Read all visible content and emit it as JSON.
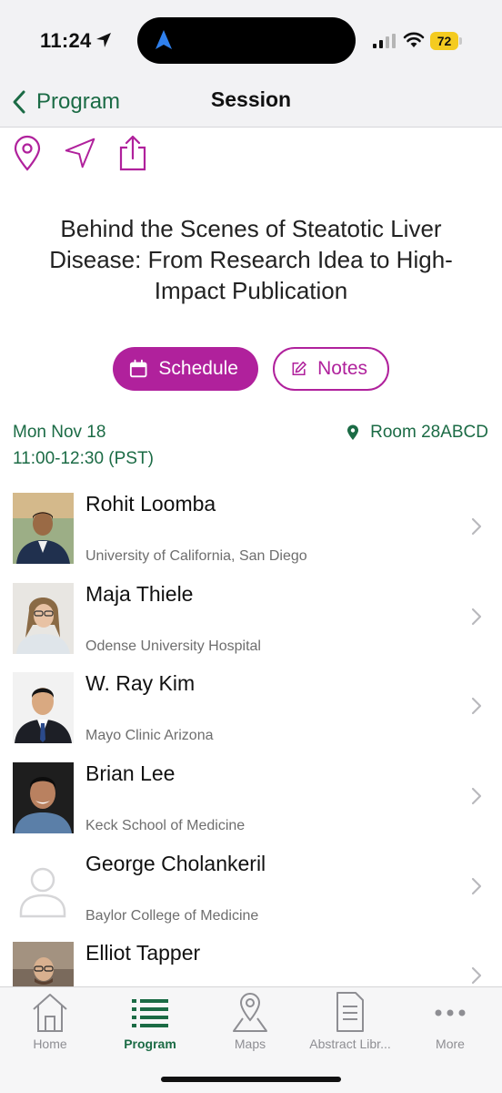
{
  "status_bar": {
    "time": "11:24",
    "battery": "72"
  },
  "nav": {
    "back_label": "Program",
    "title": "Session"
  },
  "actions": [
    {
      "icon": "location-pin-icon"
    },
    {
      "icon": "navigate-arrow-icon"
    },
    {
      "icon": "share-icon"
    }
  ],
  "session": {
    "title": "Behind the Scenes of Steatotic Liver Disease: From Research Idea to High-Impact Publication",
    "date": "Mon Nov 18",
    "time": "11:00-12:30 (PST)",
    "room": "Room 28ABCD"
  },
  "buttons": {
    "schedule": "Schedule",
    "notes": "Notes"
  },
  "speakers": [
    {
      "name": "Rohit Loomba",
      "org": "University of California, San Diego",
      "photo": "photo"
    },
    {
      "name": "Maja Thiele",
      "org": "Odense University Hospital",
      "photo": "photo"
    },
    {
      "name": "W. Ray Kim",
      "org": "Mayo Clinic Arizona",
      "photo": "photo"
    },
    {
      "name": "Brian Lee",
      "org": "Keck School of Medicine",
      "photo": "photo"
    },
    {
      "name": "George Cholankeril",
      "org": "Baylor College of Medicine",
      "photo": "placeholder"
    },
    {
      "name": "Elliot Tapper",
      "org": "",
      "photo": "photo"
    }
  ],
  "tabs": [
    {
      "label": "Home",
      "icon": "home-icon"
    },
    {
      "label": "Program",
      "icon": "list-icon",
      "active": true
    },
    {
      "label": "Maps",
      "icon": "map-pin-icon"
    },
    {
      "label": "Abstract Libr...",
      "icon": "document-icon"
    },
    {
      "label": "More",
      "icon": "more-icon"
    }
  ],
  "colors": {
    "accent": "#b0219c",
    "brand_green": "#1b6b45",
    "inactive": "#8e8e93"
  }
}
